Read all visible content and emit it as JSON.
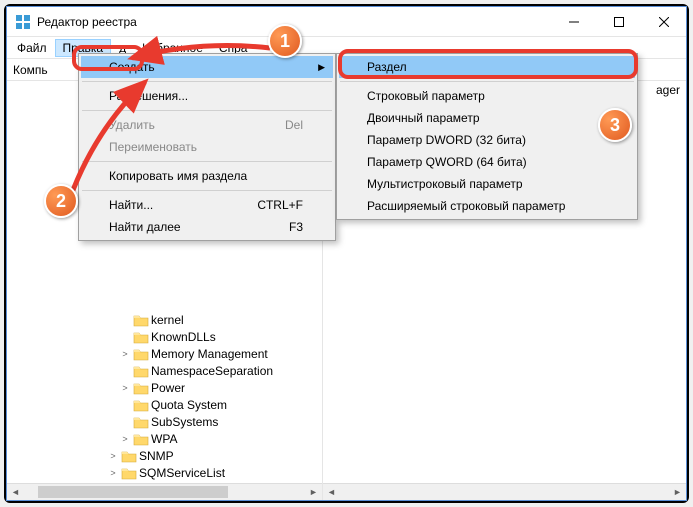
{
  "window": {
    "title": "Редактор реестра",
    "address_prefix": "Компь",
    "right_header_fragment": "ager"
  },
  "menubar": {
    "file": "Файл",
    "edit": "Правка",
    "view_fragment": "д",
    "favorites": "Избранное",
    "help": "Спра"
  },
  "edit_menu": {
    "create": "Создать",
    "permissions": "Разрешения...",
    "delete": "Удалить",
    "delete_key": "Del",
    "rename": "Переименовать",
    "copy_key_name": "Копировать имя раздела",
    "find": "Найти...",
    "find_key": "CTRL+F",
    "find_next": "Найти далее",
    "find_next_key": "F3"
  },
  "submenu": {
    "key": "Раздел",
    "string": "Строковый параметр",
    "binary": "Двоичный параметр",
    "dword": "Параметр DWORD (32 бита)",
    "qword": "Параметр QWORD (64 бита)",
    "multi_string": "Мультистроковый параметр",
    "expand_string": "Расширяемый строковый параметр"
  },
  "tree": {
    "items": [
      {
        "label": "kernel",
        "expandable": false,
        "indent": 1
      },
      {
        "label": "KnownDLLs",
        "expandable": false,
        "indent": 1
      },
      {
        "label": "Memory Management",
        "expandable": true,
        "indent": 1
      },
      {
        "label": "NamespaceSeparation",
        "expandable": false,
        "indent": 1
      },
      {
        "label": "Power",
        "expandable": true,
        "indent": 1
      },
      {
        "label": "Quota System",
        "expandable": false,
        "indent": 1
      },
      {
        "label": "SubSystems",
        "expandable": false,
        "indent": 1
      },
      {
        "label": "WPA",
        "expandable": true,
        "indent": 1
      },
      {
        "label": "SNMP",
        "expandable": true,
        "indent": 0
      },
      {
        "label": "SQMServiceList",
        "expandable": true,
        "indent": 0
      }
    ]
  },
  "badges": {
    "b1": "1",
    "b2": "2",
    "b3": "3"
  },
  "colors": {
    "accent": "#91c9f7",
    "highlight_red": "#e83a2e",
    "badge": "#e05a20"
  }
}
